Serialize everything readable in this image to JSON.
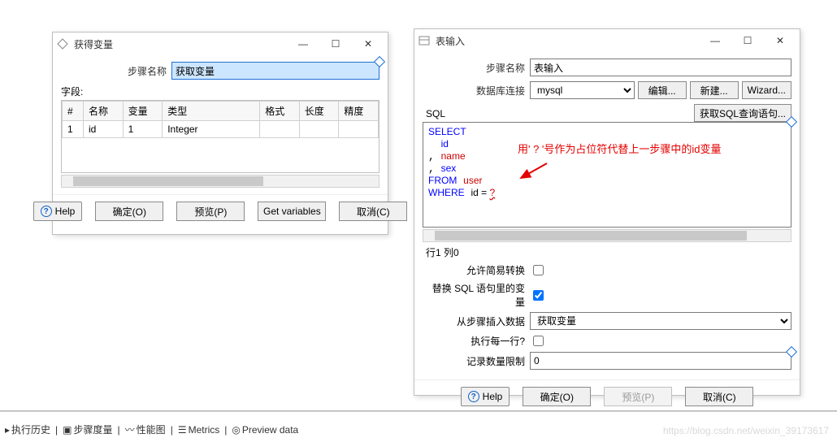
{
  "left": {
    "title": "获得变量",
    "step_label": "步骤名称",
    "step_value": "获取变量",
    "fields_label": "字段:",
    "columns": [
      "#",
      "名称",
      "变量",
      "类型",
      "格式",
      "长度",
      "精度"
    ],
    "rows": [
      {
        "n": "1",
        "name": "id",
        "var": "1",
        "type": "Integer",
        "fmt": "",
        "len": "",
        "prec": ""
      }
    ],
    "buttons": {
      "ok": "确定(O)",
      "preview": "预览(P)",
      "getvars": "Get variables",
      "cancel": "取消(C)",
      "help": "Help"
    }
  },
  "right": {
    "title": "表输入",
    "step_label": "步骤名称",
    "step_value": "表输入",
    "conn_label": "数据库连接",
    "conn_value": "mysql",
    "conn_edit": "编辑...",
    "conn_new": "新建...",
    "conn_wiz": "Wizard...",
    "sql_label": "SQL",
    "sql_get_btn": "获取SQL查询语句...",
    "sql": {
      "select": "SELECT",
      "c1": "id",
      "c2": "name",
      "c3": "sex",
      "from": "FROM",
      "tbl": "user",
      "where": "WHERE",
      "cond": "id = ",
      "ph": "?"
    },
    "annotation": "用' ? '号作为占位符代替上一步骤中的id变量",
    "status": "行1 列0",
    "allow_label": "允许简易转换",
    "replace_label": "替换 SQL 语句里的变量",
    "insert_label": "从步骤插入数据",
    "insert_value": "获取变量",
    "each_label": "执行每一行?",
    "limit_label": "记录数量限制",
    "limit_value": "0",
    "buttons": {
      "ok": "确定(O)",
      "preview": "预览(P)",
      "cancel": "取消(C)",
      "help": "Help"
    }
  },
  "tabs": {
    "t1": "执行历史",
    "t2": "步骤度量",
    "t3": "性能图",
    "t4": "Metrics",
    "t5": "Preview data"
  },
  "watermark": "https://blog.csdn.net/weixin_39173617"
}
